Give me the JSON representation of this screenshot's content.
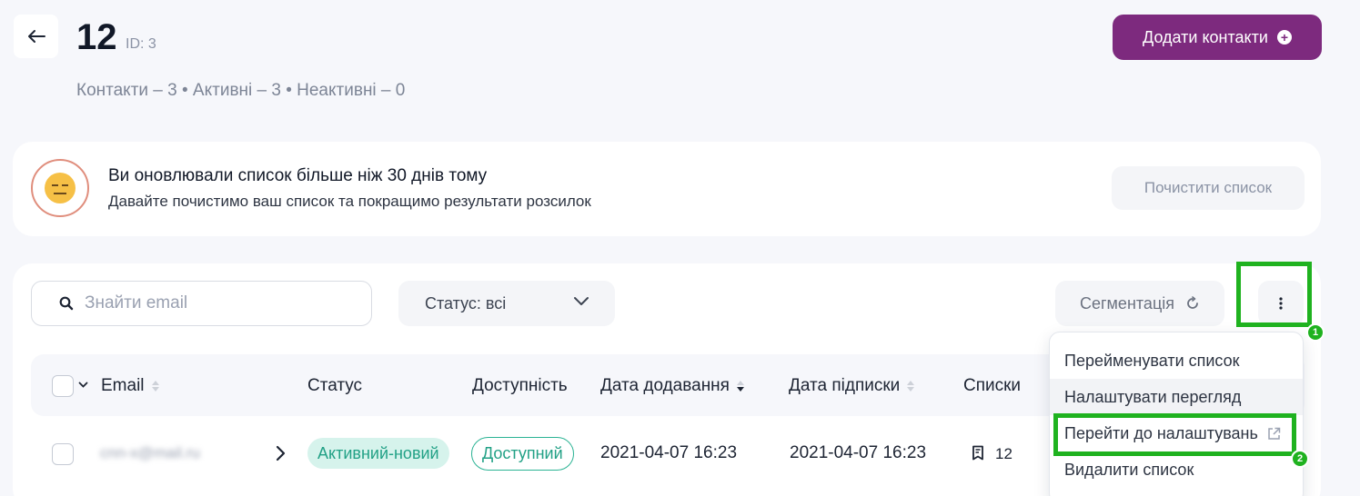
{
  "header": {
    "title": "12",
    "id_label": "ID: 3",
    "stats": "Контакти – 3 • Активні – 3 • Неактивні – 0",
    "add_button": "Додати контакти"
  },
  "banner": {
    "title": "Ви оновлювали список більше ніж 30 днів тому",
    "subtitle": "Давайте почистимо ваш список та покращимо результати розсилок",
    "clean_button": "Почистити список"
  },
  "toolbar": {
    "search_placeholder": "Знайти email",
    "status_filter": "Статус: всі",
    "segmentation": "Сегментація"
  },
  "table": {
    "columns": [
      "Email",
      "Статус",
      "Доступність",
      "Дата додавання",
      "Дата підписки",
      "Списки"
    ],
    "rows": [
      {
        "email": "cnn-x@mail.ru",
        "status": "Активний-новий",
        "availability": "Доступний",
        "date_added": "2021-04-07 16:23",
        "date_subscribed": "2021-04-07 16:23",
        "lists": "12"
      }
    ]
  },
  "menu": {
    "items": [
      "Перейменувати список",
      "Налаштувати перегляд",
      "Перейти до налаштувань",
      "Видалити список"
    ]
  },
  "annotations": {
    "badge_1": "1",
    "badge_2": "2",
    "color": "#1fb21f"
  },
  "colors": {
    "brand": "#7d2a7e",
    "success": "#22a186"
  }
}
